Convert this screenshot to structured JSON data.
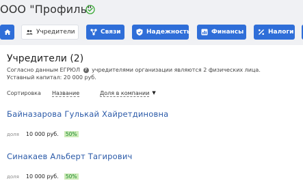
{
  "header": {
    "company_name": "ООО \"Профиль\"",
    "verified_icon": "check-circle-icon",
    "colors": {
      "verified": "#3aaa35"
    }
  },
  "tabs": [
    {
      "label": "",
      "icon": "home-icon",
      "active": false
    },
    {
      "label": "Учредители",
      "icon": "people-icon",
      "active": true
    },
    {
      "label": "Связи",
      "icon": "network-icon",
      "active": false
    },
    {
      "label": "Надежность",
      "icon": "shield-check-icon",
      "active": false
    },
    {
      "label": "Финансы",
      "icon": "bar-chart-icon",
      "active": false
    },
    {
      "label": "Налоги",
      "icon": "percent-icon",
      "active": false
    }
  ],
  "colors": {
    "tab_bg": "#2f6ed8",
    "link": "#2b5aa8",
    "share_badge_bg": "#cdebb8",
    "share_badge_text": "#1e8a2e"
  },
  "founders_section": {
    "title": "Учредители (2)",
    "desc_before": "Согласно данным ЕГРЮЛ",
    "desc_after": "учредителями организации являются 2 физических лица.",
    "capital": "Уставный капитал: 20 000 руб.",
    "sort_label": "Сортировка",
    "sort_options": [
      "Название",
      "Доля в компании"
    ],
    "share_label": "доля"
  },
  "founders": [
    {
      "name": "Байназарова Гулькай Хайретдиновна",
      "share_amount": "10 000 руб.",
      "share_percent": "50%"
    },
    {
      "name": "Синакаев Альберт Тагирович",
      "share_amount": "10 000 руб.",
      "share_percent": "50%"
    }
  ]
}
